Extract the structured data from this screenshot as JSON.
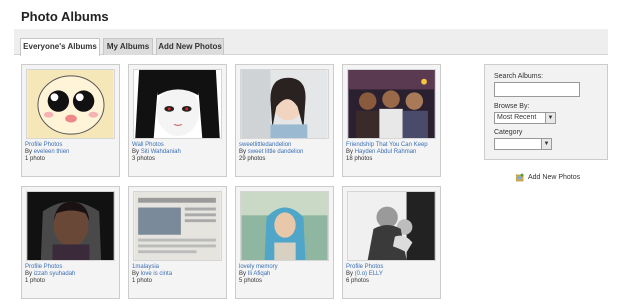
{
  "page": {
    "title": "Photo Albums"
  },
  "tabs": [
    {
      "label": "Everyone's Albums",
      "active": true
    },
    {
      "label": "My Albums",
      "active": false
    },
    {
      "label": "Add New Photos",
      "active": false
    }
  ],
  "albums": [
    {
      "title": "Profile Photos",
      "by": "By",
      "author": "eveleen thien",
      "count": "1 photo",
      "thumb": "cartoon-face"
    },
    {
      "title": "Wall Photos",
      "by": "By",
      "author": "Siti Wahdaniah",
      "count": "3 photos",
      "thumb": "anime-girl"
    },
    {
      "title": "sweetlittledandelion",
      "by": "By",
      "author": "sweet little dandelion",
      "count": "29 photos",
      "thumb": "girl-portrait"
    },
    {
      "title": "Friendship That You Can Keep",
      "by": "By",
      "author": "Hayden Abdul Rahman",
      "count": "18 photos",
      "thumb": "group-photo"
    },
    {
      "title": "Profile Photos",
      "by": "By",
      "author": "izzah syuhadah",
      "count": "1 photo",
      "thumb": "person-photo"
    },
    {
      "title": "1malaysia",
      "by": "By",
      "author": "love is cinta",
      "count": "1 photo",
      "thumb": "newspaper"
    },
    {
      "title": "lovely memory",
      "by": "By",
      "author": "Ili Afiqah",
      "count": "5 photos",
      "thumb": "hijab-girl"
    },
    {
      "title": "Profile Photos",
      "by": "By",
      "author": "(0.o) ELLY",
      "count": "6 photos",
      "thumb": "bw-photo"
    }
  ],
  "sidebar": {
    "search_label": "Search Albums:",
    "search_value": "",
    "browse_label": "Browse By:",
    "browse_value": "Most Recent",
    "category_label": "Category",
    "category_value": ""
  },
  "actions": {
    "add_new_photos": "Add New Photos"
  },
  "colors": {
    "link": "#3b6fb6",
    "tabbar_bg": "#eeeeee",
    "card_bg": "#f4f4f4"
  }
}
